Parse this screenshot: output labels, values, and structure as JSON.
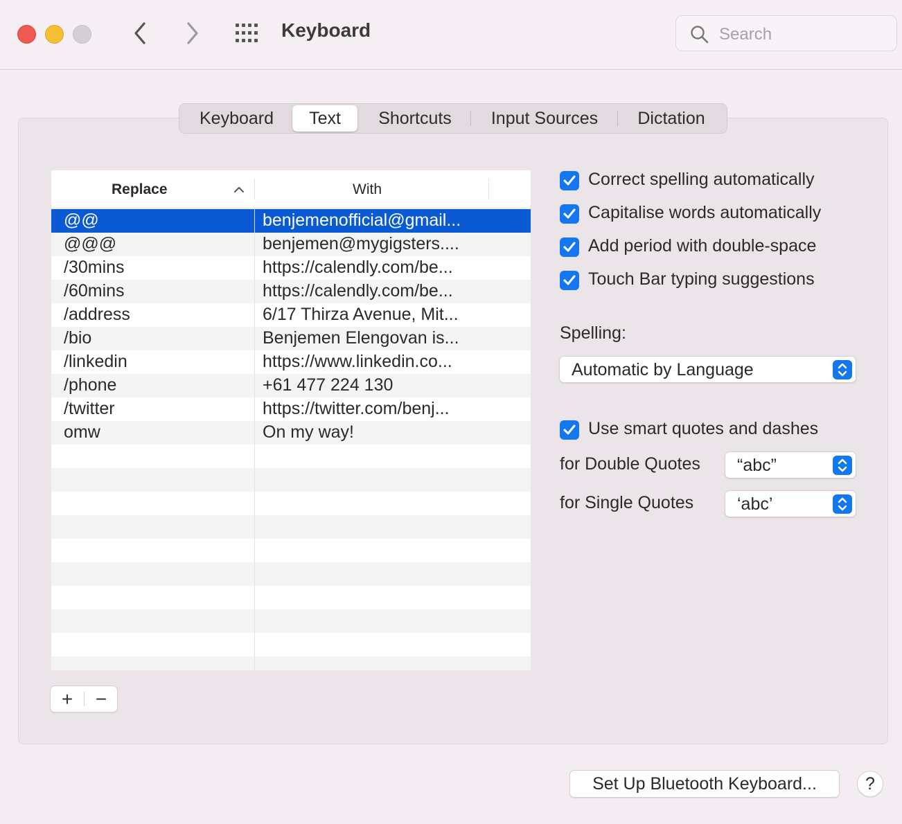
{
  "window": {
    "title": "Keyboard",
    "search_placeholder": "Search"
  },
  "tabs": [
    {
      "label": "Keyboard",
      "active": false
    },
    {
      "label": "Text",
      "active": true
    },
    {
      "label": "Shortcuts",
      "active": false
    },
    {
      "label": "Input Sources",
      "active": false
    },
    {
      "label": "Dictation",
      "active": false
    }
  ],
  "table": {
    "columns": [
      "Replace",
      "With"
    ],
    "sort": "ascending",
    "rows": [
      {
        "replace": "@@",
        "with": "benjemenofficial@gmail...",
        "selected": true
      },
      {
        "replace": "@@@",
        "with": "benjemen@mygigsters....",
        "selected": false
      },
      {
        "replace": "/30mins",
        "with": "https://calendly.com/be...",
        "selected": false
      },
      {
        "replace": "/60mins",
        "with": "https://calendly.com/be...",
        "selected": false
      },
      {
        "replace": "/address",
        "with": "6/17 Thirza Avenue, Mit...",
        "selected": false
      },
      {
        "replace": "/bio",
        "with": "Benjemen Elengovan is...",
        "selected": false
      },
      {
        "replace": "/linkedin",
        "with": "https://www.linkedin.co...",
        "selected": false
      },
      {
        "replace": "/phone",
        "with": "+61 477 224 130",
        "selected": false
      },
      {
        "replace": "/twitter",
        "with": "https://twitter.com/benj...",
        "selected": false
      },
      {
        "replace": "omw",
        "with": "On my way!",
        "selected": false
      }
    ],
    "add_label": "+",
    "remove_label": "−"
  },
  "options": {
    "correct_spelling": {
      "label": "Correct spelling automatically",
      "checked": true
    },
    "capitalise": {
      "label": "Capitalise words automatically",
      "checked": true
    },
    "add_period": {
      "label": "Add period with double-space",
      "checked": true
    },
    "touch_bar": {
      "label": "Touch Bar typing suggestions",
      "checked": true
    },
    "spelling_label": "Spelling:",
    "spelling_value": "Automatic by Language",
    "smart_quotes": {
      "label": "Use smart quotes and dashes",
      "checked": true
    },
    "double_quotes_label": "for Double Quotes",
    "double_quotes_value": "“abc”",
    "single_quotes_label": "for Single Quotes",
    "single_quotes_value": "‘abc’"
  },
  "footer": {
    "bluetooth_button": "Set Up Bluetooth Keyboard...",
    "help_button": "?"
  },
  "colors": {
    "accent": "#1377ee",
    "selection": "#0a5bd3",
    "close": "#ee5a52",
    "minimize": "#f4bf34",
    "zoom_disabled": "#d4cfd3"
  }
}
